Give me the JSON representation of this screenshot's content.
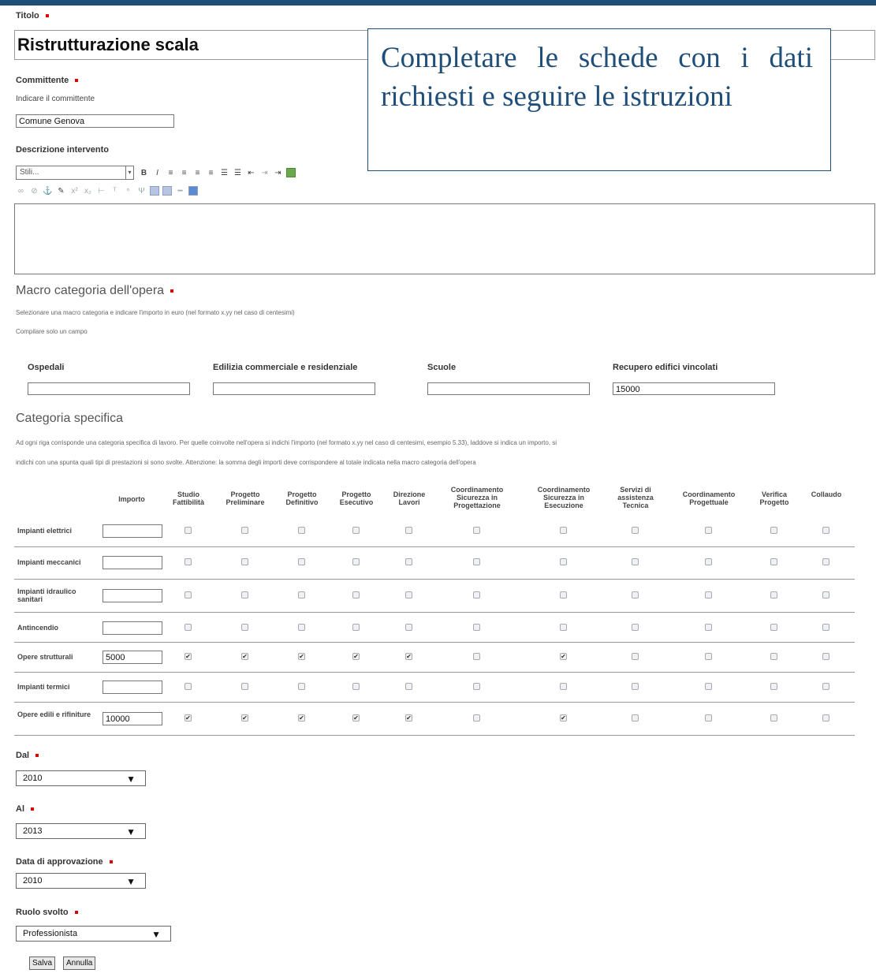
{
  "form": {
    "title_label": "Titolo",
    "title_value": "Ristrutturazione scala",
    "client_label": "Committente",
    "client_hint": "Indicare il committente",
    "client_value": "Comune Genova",
    "description_label": "Descrizione intervento",
    "style_select_value": "Stili..."
  },
  "callout": {
    "text": "Completare le schede con i dati richiesti e seguire le istruzioni"
  },
  "toolbar": {
    "row1": [
      "B",
      "I",
      "≡",
      "≡",
      "≡",
      "≡",
      "☰",
      "☰",
      "⇤",
      "⇥",
      "⇥"
    ],
    "row2": [
      "∞",
      "⊘",
      "⚓",
      "✎",
      "x²",
      "x₂",
      "⊢",
      "ᵀ",
      "ⁿ",
      "Ψ",
      "▦",
      "▦",
      "━",
      "▣"
    ]
  },
  "macro": {
    "heading": "Macro categoria dell'opera",
    "hint1": "Selezionare una macro categoria e indicare l'importo in euro (nel formato x.yy nel caso di centesimi)",
    "hint2": "Compilare solo un campo",
    "fields": [
      {
        "label": "Ospedali",
        "value": ""
      },
      {
        "label": "Edilizia commerciale e residenziale",
        "value": ""
      },
      {
        "label": "Scuole",
        "value": ""
      },
      {
        "label": "Recupero edifici vincolati",
        "value": "15000"
      }
    ]
  },
  "specific": {
    "heading": "Categoria specifica",
    "hint1": "Ad ogni riga corrisponde una categoria specifica di lavoro. Per quelle coinvolte nell'opera si indichi l'importo (nel formato x.yy nel caso di centesimi, esempio 5.33), laddove si indica un importo, si",
    "hint2": "indichi con una spunta quali tipi di prestazioni si sono svolte. Attenzione: la somma degli importi deve corrispondere al totale indicata nella macro categoria dell'opera",
    "columns": [
      "Importo",
      "Studio Fattibilità",
      "Progetto Preliminare",
      "Progetto Definitivo",
      "Progetto Esecutivo",
      "Direzione Lavori",
      "Coordinamento Sicurezza in Progettazione",
      "Coordinamento Sicurezza in Esecuzione",
      "Servizi di assistenza Tecnica",
      "Coordinamento Progettuale",
      "Verifica Progetto",
      "Collaudo"
    ],
    "rows": [
      {
        "label": "Impianti elettrici",
        "importo": "",
        "checks": [
          false,
          false,
          false,
          false,
          false,
          false,
          false,
          false,
          false,
          false,
          false
        ]
      },
      {
        "label": "Impianti meccanici",
        "importo": "",
        "checks": [
          false,
          false,
          false,
          false,
          false,
          false,
          false,
          false,
          false,
          false,
          false
        ]
      },
      {
        "label": "Impianti idraulico sanitari",
        "importo": "",
        "checks": [
          false,
          false,
          false,
          false,
          false,
          false,
          false,
          false,
          false,
          false,
          false
        ]
      },
      {
        "label": "Antincendio",
        "importo": "",
        "checks": [
          false,
          false,
          false,
          false,
          false,
          false,
          false,
          false,
          false,
          false,
          false
        ]
      },
      {
        "label": "Opere strutturali",
        "importo": "5000",
        "checks": [
          true,
          true,
          true,
          true,
          true,
          false,
          true,
          false,
          false,
          false,
          false
        ]
      },
      {
        "label": "Impianti termici",
        "importo": "",
        "checks": [
          false,
          false,
          false,
          false,
          false,
          false,
          false,
          false,
          false,
          false,
          false
        ]
      },
      {
        "label": "Opere edili e rifiniture",
        "importo": "10000",
        "checks": [
          true,
          true,
          true,
          true,
          true,
          false,
          true,
          false,
          false,
          false,
          false
        ]
      }
    ]
  },
  "dates": {
    "from_label": "Dal",
    "from_value": "2010",
    "to_label": "Al",
    "to_value": "2013",
    "approval_label": "Data di approvazione",
    "approval_value": "2010"
  },
  "role": {
    "label": "Ruolo svolto",
    "value": "Professionista"
  },
  "buttons": {
    "save": "Salva",
    "cancel": "Annulla"
  }
}
